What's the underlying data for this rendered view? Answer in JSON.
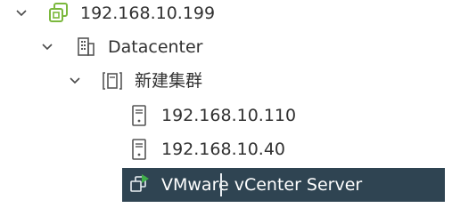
{
  "tree": {
    "root": {
      "label": "192.168.10.199",
      "icon": "vcenter-icon",
      "expanded": true
    },
    "datacenter": {
      "label": "Datacenter",
      "icon": "datacenter-icon",
      "expanded": true
    },
    "cluster": {
      "label": "新建集群",
      "icon": "cluster-icon",
      "expanded": true
    },
    "hosts": [
      {
        "label": "192.168.10.110",
        "icon": "host-icon"
      },
      {
        "label": "192.168.10.40",
        "icon": "host-icon"
      }
    ],
    "vm": {
      "label": "VMware vCenter Server",
      "icon": "vm-powered-on-icon",
      "selected": true
    }
  },
  "colors": {
    "vcenter_icon": "#7bb83d",
    "selected_bg": "#2f4452",
    "text": "#313131",
    "chevron": "#4a4a4a",
    "vm_play": "#3fae49"
  }
}
